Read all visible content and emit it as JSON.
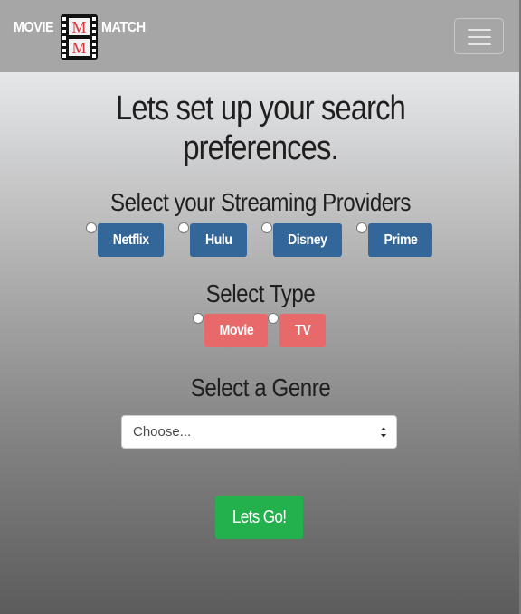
{
  "navbar": {
    "brand_left": "MOVIE",
    "brand_right": "MATCH",
    "logo_letter_top": "M",
    "logo_letter_bottom": "M"
  },
  "main": {
    "heading_line1": "Lets set up your search",
    "heading_line2": "preferences.",
    "providers_title": "Select your Streaming Providers",
    "providers": [
      "Netflix",
      "Hulu",
      "Disney",
      "Prime"
    ],
    "type_title": "Select Type",
    "types": [
      "Movie",
      "TV"
    ],
    "genre_title": "Select a Genre",
    "genre_select_value": "Choose...",
    "submit_label": "Lets Go!"
  },
  "colors": {
    "navbar_bg": "#a6a6a6",
    "provider_button": "#336799",
    "type_button": "#e8696a",
    "submit_button": "#22b14c"
  }
}
